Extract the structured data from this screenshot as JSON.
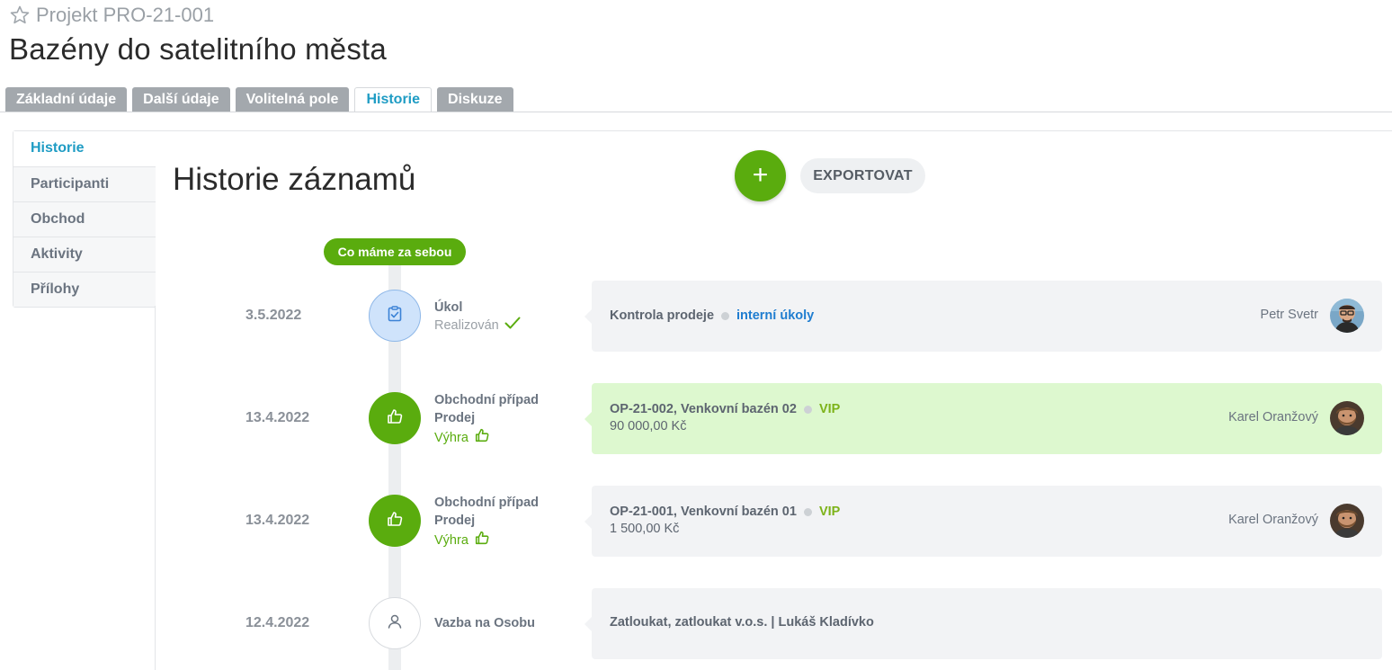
{
  "header": {
    "project_code": "Projekt PRO-21-001",
    "title": "Bazény do satelitního města"
  },
  "tabs": [
    {
      "label": "Základní údaje"
    },
    {
      "label": "Další údaje"
    },
    {
      "label": "Volitelná pole"
    },
    {
      "label": "Historie",
      "active": true
    },
    {
      "label": "Diskuze"
    }
  ],
  "sidenav": [
    {
      "label": "Historie"
    },
    {
      "label": "Participanti"
    },
    {
      "label": "Obchod"
    },
    {
      "label": "Aktivity"
    },
    {
      "label": "Přílohy"
    }
  ],
  "main": {
    "title": "Historie záznamů",
    "add_label": "+",
    "export_label": "EXPORTOVAT",
    "timeline_label": "Co máme za sebou"
  },
  "rows": [
    {
      "date": "3.5.2022",
      "icon": "task-check-icon",
      "type": "Úkol",
      "status": "Realizován",
      "card_title": "Kontrola prodeje",
      "card_tag": "interní úkoly",
      "user": "Petr Svetr"
    },
    {
      "date": "13.4.2022",
      "icon": "thumbs-up-icon",
      "type": "Obchodní případ",
      "sub": "Prodej",
      "status": "Výhra",
      "card_title": "OP-21-002, Venkovní bazén 02",
      "card_tag": "VIP",
      "card_value": "90 000,00 Kč",
      "user": "Karel Oranžový"
    },
    {
      "date": "13.4.2022",
      "icon": "thumbs-up-icon",
      "type": "Obchodní případ",
      "sub": "Prodej",
      "status": "Výhra",
      "card_title": "OP-21-001, Venkovní bazén 01",
      "card_tag": "VIP",
      "card_value": "1 500,00 Kč",
      "user": "Karel Oranžový"
    },
    {
      "date": "12.4.2022",
      "icon": "person-icon",
      "type": "Vazba na Osobu",
      "card_title": "Zatloukat, zatloukat v.o.s. | Lukáš Kladívko"
    }
  ],
  "colors": {
    "accent": "#1f9cc4",
    "green": "#5aac0e",
    "card_bg": "#f2f3f5",
    "card_win_bg": "#ddf8cf"
  }
}
